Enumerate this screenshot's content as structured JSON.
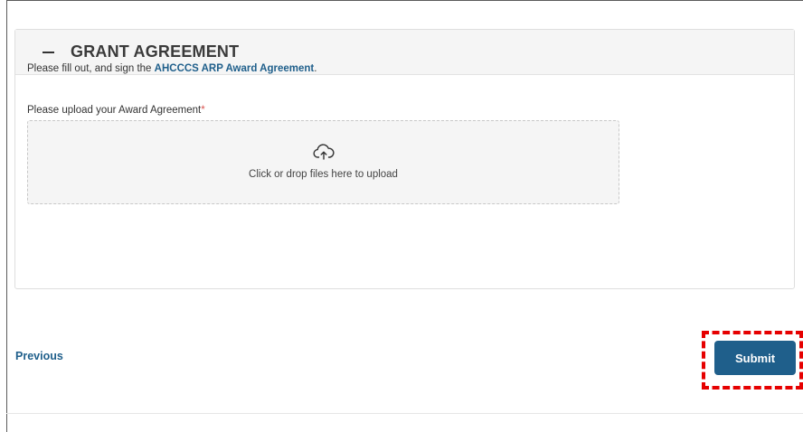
{
  "section": {
    "title": "GRANT AGREEMENT",
    "collapse_icon": "minus-icon"
  },
  "intro": {
    "prefix": "Please fill out, and sign the ",
    "link_text": "AHCCCS ARP Award Agreement",
    "suffix": "."
  },
  "upload": {
    "label": "Please upload your Award Agreement",
    "required_marker": "*",
    "icon": "cloud-upload-icon",
    "dropzone_text": "Click or drop files here to upload"
  },
  "nav": {
    "previous_label": "Previous",
    "submit_label": "Submit"
  },
  "colors": {
    "link": "#1f5f8b",
    "button_bg": "#1f5f8b",
    "required": "#d9534f",
    "highlight": "#e60000"
  }
}
